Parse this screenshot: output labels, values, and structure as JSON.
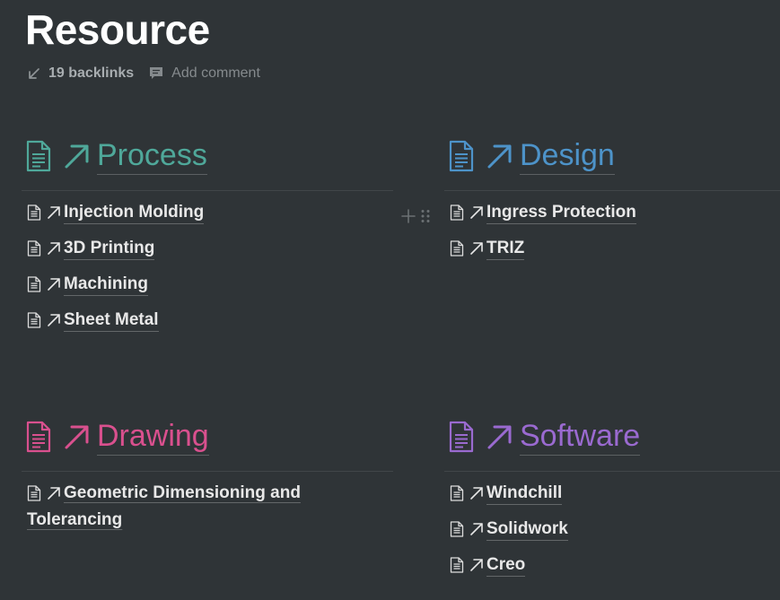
{
  "page": {
    "title": "Resource",
    "backlinks_label": "19 backlinks",
    "comment_label": "Add comment"
  },
  "colors": {
    "background": "#2f3437",
    "process": "#4fa89a",
    "design": "#4d93c9",
    "drawing": "#d9508e",
    "software": "#9a6ad0"
  },
  "sections": {
    "process": {
      "title": "Process",
      "items": [
        "Injection Molding",
        "3D Printing",
        "Machining",
        "Sheet Metal"
      ]
    },
    "design": {
      "title": "Design",
      "items": [
        "Ingress Protection",
        "TRIZ"
      ]
    },
    "drawing": {
      "title": "Drawing",
      "items": [
        "Geometric Dimensioning and Tolerancing"
      ]
    },
    "software": {
      "title": "Software",
      "items": [
        "Windchill",
        "Solidwork",
        "Creo"
      ]
    }
  },
  "icons": {
    "backlinks": "arrow-down-left-icon",
    "comment": "comment-icon",
    "page": "document-icon",
    "link": "arrow-up-right-icon",
    "add": "plus-icon",
    "drag": "drag-handle-icon"
  }
}
